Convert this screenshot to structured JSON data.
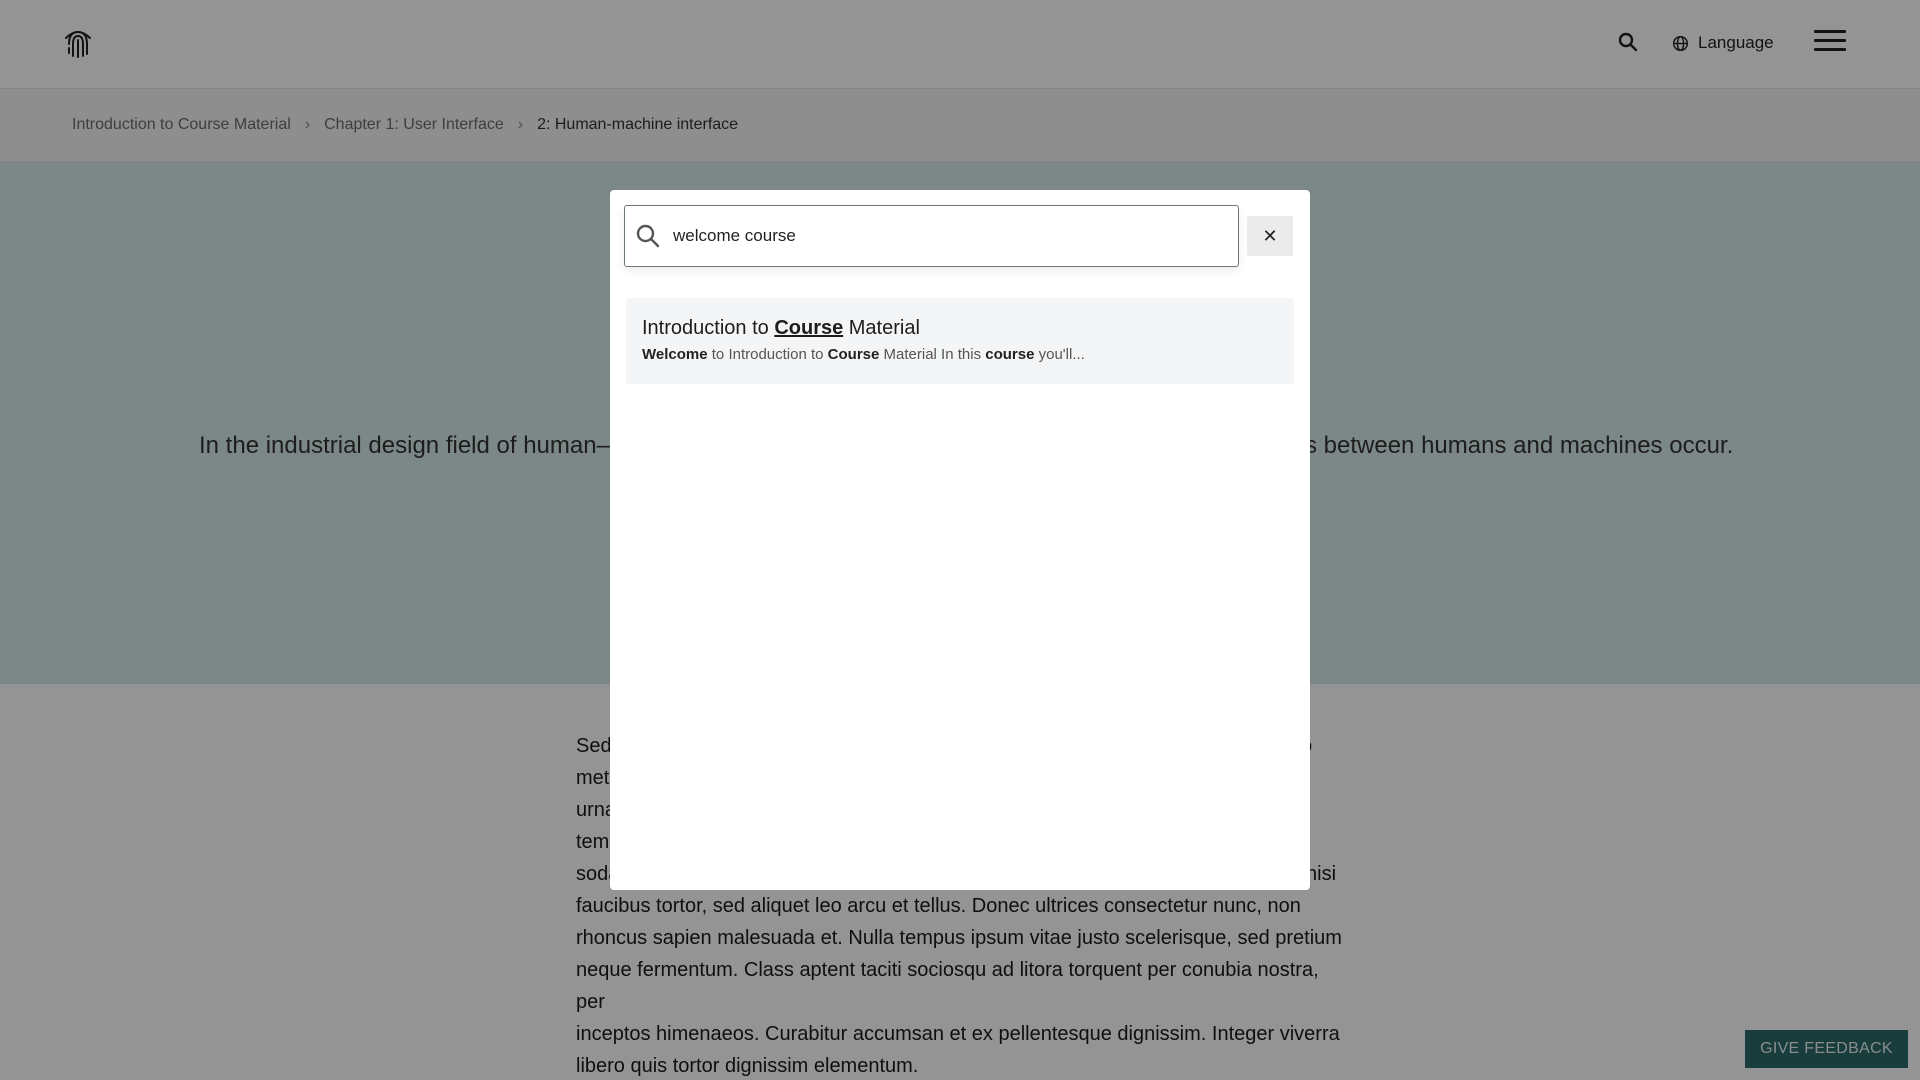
{
  "header": {
    "language_label": "Language"
  },
  "breadcrumb": {
    "items": [
      "Introduction to Course Material",
      "Chapter 1: User Interface"
    ],
    "separator": "›",
    "current": "2: Human-machine interface"
  },
  "hero": {
    "text_left": "In the industrial design field of human–c",
    "text_right": "s between humans and machines occur."
  },
  "body": {
    "paragraph_lines": [
      "Sed",
      "met",
      "urna",
      "tem",
      "soda",
      "faucibus tortor, sed aliquet leo arcu et tellus. Donec ultrices consectetur nunc, non",
      "rhoncus sapien malesuada et. Nulla tempus ipsum vitae justo scelerisque, sed pretium",
      "neque fermentum. Class aptent taciti sociosqu ad litora torquent per conubia nostra, per",
      "inceptos himenaeos. Curabitur accumsan et ex pellentesque dignissim. Integer viverra",
      "libero quis tortor dignissim elementum."
    ],
    "right_fragments": [
      "o",
      "nisi"
    ]
  },
  "search_modal": {
    "query": "welcome course",
    "close_symbol": "✕",
    "result": {
      "title_pre": "Introduction to ",
      "title_match": "Course",
      "title_post": " Material",
      "snippet_w1": "Welcome",
      "snippet_t1": " to Introduction to ",
      "snippet_w2": "Course",
      "snippet_t2": " Material In this ",
      "snippet_w3": "course",
      "snippet_t3": " you'll..."
    }
  },
  "feedback_button": {
    "label": "GIVE FEEDBACK"
  },
  "colors": {
    "hero_bg": "#d6ebe8",
    "feedback_bg": "#2a6a68",
    "overlay": "rgba(0,0,0,0.42)"
  },
  "icons": [
    "fingerprint-logo-icon",
    "search-icon",
    "globe-icon",
    "hamburger-menu-icon",
    "close-icon"
  ]
}
